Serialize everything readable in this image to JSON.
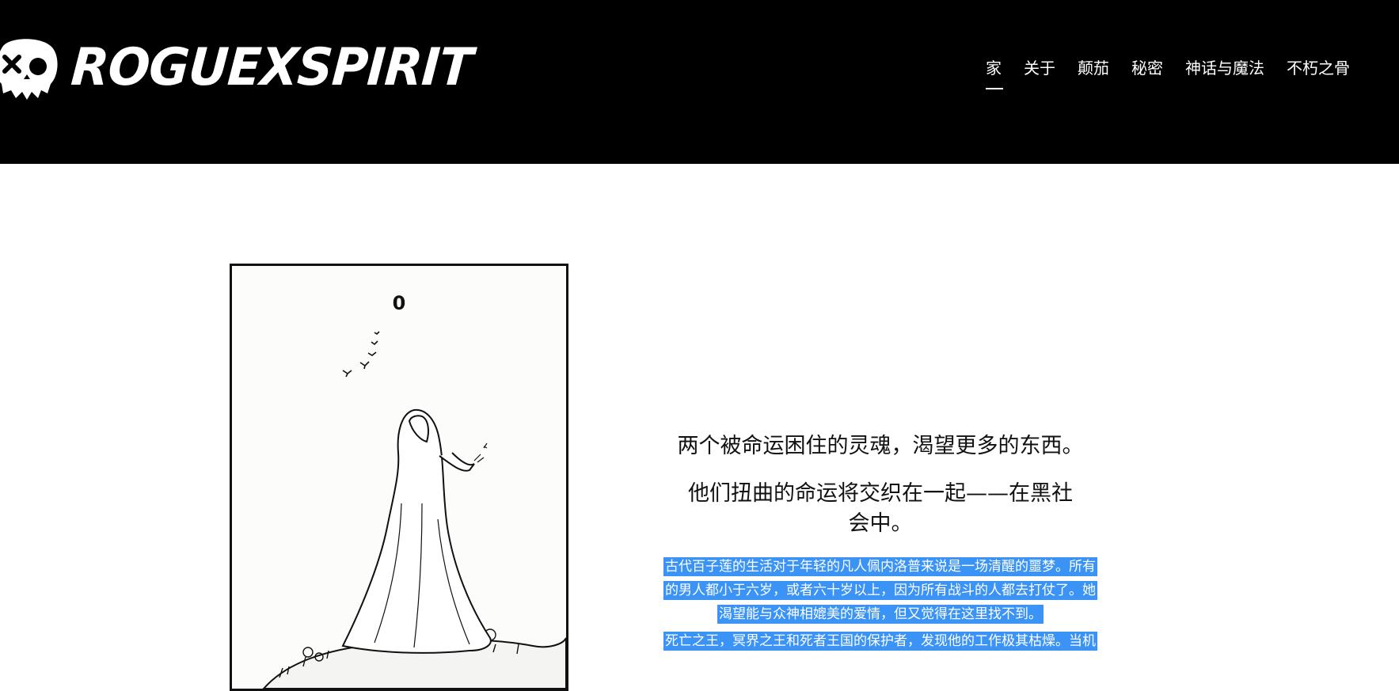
{
  "header": {
    "logo_text": "ROGUEXSPIRIT",
    "nav": [
      {
        "label": "家",
        "active": true
      },
      {
        "label": "关于"
      },
      {
        "label": "颠茄"
      },
      {
        "label": "秘密"
      },
      {
        "label": "神话与魔法"
      },
      {
        "label": "不朽之骨"
      }
    ]
  },
  "card": {
    "number": "0"
  },
  "main": {
    "tagline": "两个被命运困住的灵魂，渴望更多的东西。",
    "tagline2": "他们扭曲的命运将交织在一起——在黑社会中。",
    "paragraph1": "古代百子莲的生活对于年轻的凡人佩内洛普来说是一场清醒的噩梦。所有的男人都小于六岁，或者六十岁以上，因为所有战斗的人都去打仗了。她渴望能与众神相媲美的爱情，但又觉得在这里找不到。",
    "paragraph2": "死亡之王，冥界之王和死者王国的保护者，发现他的工作极其枯燥。当机"
  },
  "colors": {
    "header_bg": "#000000",
    "selection": "#3b94f5"
  }
}
